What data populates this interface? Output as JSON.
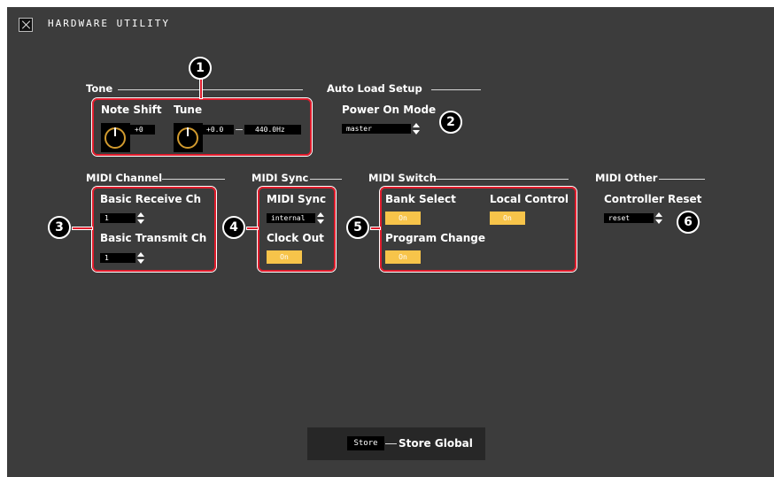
{
  "app": {
    "title": "HARDWARE UTILITY",
    "close_icon": "close-x-icon"
  },
  "tone": {
    "section_label": "Tone",
    "note_shift_label": "Note Shift",
    "note_shift_value": "+0",
    "tune_label": "Tune",
    "tune_value": "+0.0",
    "tune_hz": "440.0Hz"
  },
  "auto_load": {
    "section_label": "Auto Load Setup",
    "power_on_mode_label": "Power On Mode",
    "power_on_mode_value": "master"
  },
  "midi_channel": {
    "section_label": "MIDI Channel",
    "basic_receive_label": "Basic Receive Ch",
    "basic_receive_value": "1",
    "basic_transmit_label": "Basic Transmit Ch",
    "basic_transmit_value": "1"
  },
  "midi_sync": {
    "section_label": "MIDI Sync",
    "midi_sync_label": "MIDI Sync",
    "midi_sync_value": "internal",
    "clock_out_label": "Clock Out",
    "clock_out_value": "On"
  },
  "midi_switch": {
    "section_label": "MIDI Switch",
    "bank_select_label": "Bank Select",
    "bank_select_value": "On",
    "local_control_label": "Local Control",
    "local_control_value": "On",
    "program_change_label": "Program Change",
    "program_change_value": "On"
  },
  "midi_other": {
    "section_label": "MIDI Other",
    "controller_reset_label": "Controller Reset",
    "controller_reset_value": "reset"
  },
  "callouts": [
    "1",
    "2",
    "3",
    "4",
    "5",
    "6"
  ],
  "store": {
    "button_label": "Store",
    "label": "Store Global"
  },
  "colors": {
    "panel": "#3c3c3c",
    "highlight": "#e01c2c",
    "toggle_on": "#f7c44a",
    "knob_ring": "#d19a2e"
  }
}
